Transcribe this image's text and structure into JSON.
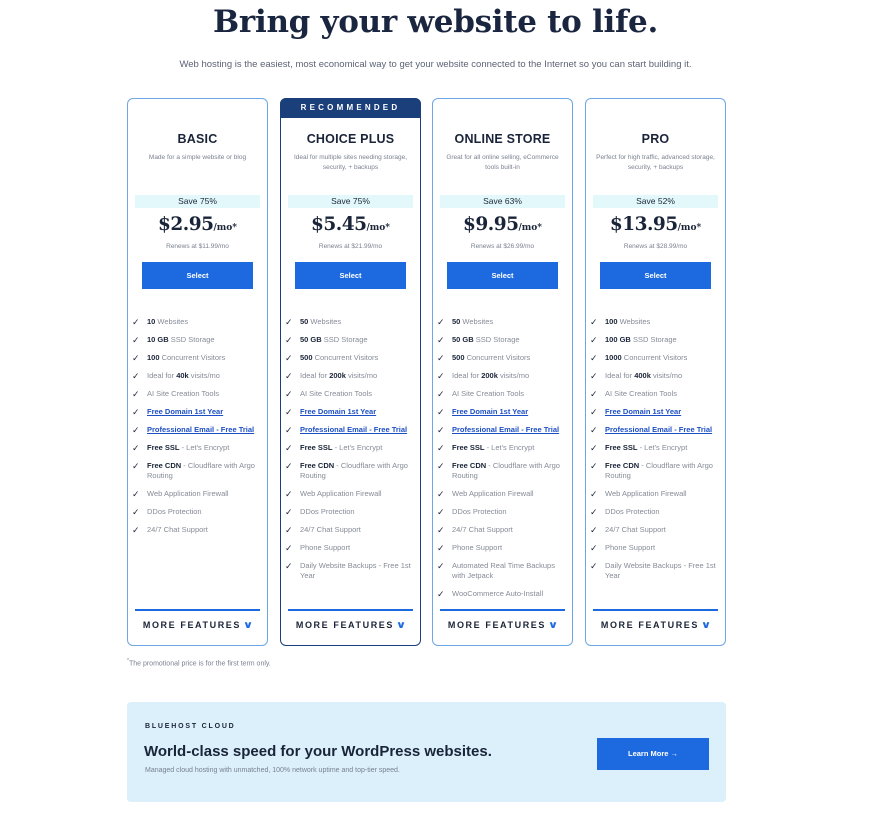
{
  "hero": {
    "title": "Bring your website to life.",
    "subtitle": "Web hosting is the easiest, most economical way to get your website connected to the Internet so you can start building it."
  },
  "colors": {
    "primary_blue": "#1d6ae0",
    "navy": "#1b3f7a",
    "card_border": "#6ea6e6",
    "save_badge_bg": "#e3f8fb",
    "cloud_bg": "#dbf0fb"
  },
  "plans": [
    {
      "name": "BASIC",
      "recommended": false,
      "description": "Made for a simple website or blog",
      "save": "Save 75%",
      "price": "$2.95",
      "per": "/mo*",
      "renews": "Renews at $11.99/mo",
      "select_label": "Select",
      "more_features_label": "MORE FEATURES",
      "features": [
        {
          "bold": "10",
          "text": " Websites"
        },
        {
          "bold": "10 GB",
          "text": " SSD Storage"
        },
        {
          "bold": "100",
          "text": " Concurrent Visitors"
        },
        {
          "pre": "Ideal for ",
          "bold": "40k",
          "text": " visits/mo"
        },
        {
          "text": "AI Site Creation Tools"
        },
        {
          "link": "Free Domain 1st Year"
        },
        {
          "link": "Professional Email - Free Trial"
        },
        {
          "bold": "Free SSL",
          "text": " - Let's Encrypt"
        },
        {
          "bold": "Free CDN",
          "text": " - Cloudflare with Argo Routing"
        },
        {
          "text": "Web Application Firewall"
        },
        {
          "text": "DDos Protection"
        },
        {
          "text": "24/7 Chat Support"
        }
      ]
    },
    {
      "name": "CHOICE PLUS",
      "recommended": true,
      "recommended_label": "RECOMMENDED",
      "description": "Ideal for multiple sites needing storage, security, + backups",
      "save": "Save 75%",
      "price": "$5.45",
      "per": "/mo*",
      "renews": "Renews at $21.99/mo",
      "select_label": "Select",
      "more_features_label": "MORE FEATURES",
      "features": [
        {
          "bold": "50",
          "text": " Websites"
        },
        {
          "bold": "50 GB",
          "text": " SSD Storage"
        },
        {
          "bold": "500",
          "text": " Concurrent Visitors"
        },
        {
          "pre": "Ideal for ",
          "bold": "200k",
          "text": " visits/mo"
        },
        {
          "text": "AI Site Creation Tools"
        },
        {
          "link": "Free Domain 1st Year"
        },
        {
          "link": "Professional Email - Free Trial"
        },
        {
          "bold": "Free SSL",
          "text": " - Let's Encrypt"
        },
        {
          "bold": "Free CDN",
          "text": " - Cloudflare with Argo Routing"
        },
        {
          "text": "Web Application Firewall"
        },
        {
          "text": "DDos Protection"
        },
        {
          "text": "24/7 Chat Support"
        },
        {
          "text": "Phone Support"
        },
        {
          "text": "Daily Website Backups - Free 1st Year"
        }
      ]
    },
    {
      "name": "ONLINE STORE",
      "recommended": false,
      "description": "Great for all online selling, eCommerce tools built-in",
      "save": "Save 63%",
      "price": "$9.95",
      "per": "/mo*",
      "renews": "Renews at $26.99/mo",
      "select_label": "Select",
      "more_features_label": "MORE FEATURES",
      "features": [
        {
          "bold": "50",
          "text": " Websites"
        },
        {
          "bold": "50 GB",
          "text": " SSD Storage"
        },
        {
          "bold": "500",
          "text": " Concurrent Visitors"
        },
        {
          "pre": "Ideal for ",
          "bold": "200k",
          "text": " visits/mo"
        },
        {
          "text": "AI Site Creation Tools"
        },
        {
          "link": "Free Domain 1st Year"
        },
        {
          "link": "Professional Email - Free Trial"
        },
        {
          "bold": "Free SSL",
          "text": " - Let's Encrypt"
        },
        {
          "bold": "Free CDN",
          "text": " - Cloudflare with Argo Routing"
        },
        {
          "text": "Web Application Firewall"
        },
        {
          "text": "DDos Protection"
        },
        {
          "text": "24/7 Chat Support"
        },
        {
          "text": "Phone Support"
        },
        {
          "text": "Automated Real Time Backups with Jetpack"
        },
        {
          "text": "WooCommerce Auto-Install"
        }
      ]
    },
    {
      "name": "PRO",
      "recommended": false,
      "description": "Perfect for high traffic, advanced storage, security, + backups",
      "save": "Save 52%",
      "price": "$13.95",
      "per": "/mo*",
      "renews": "Renews at $28.99/mo",
      "select_label": "Select",
      "more_features_label": "MORE FEATURES",
      "features": [
        {
          "bold": "100",
          "text": " Websites"
        },
        {
          "bold": "100 GB",
          "text": " SSD Storage"
        },
        {
          "bold": "1000",
          "text": " Concurrent Visitors"
        },
        {
          "pre": "Ideal for ",
          "bold": "400k",
          "text": " visits/mo"
        },
        {
          "text": "AI Site Creation Tools"
        },
        {
          "link": "Free Domain 1st Year"
        },
        {
          "link": "Professional Email - Free Trial"
        },
        {
          "bold": "Free SSL",
          "text": " - Let's Encrypt"
        },
        {
          "bold": "Free CDN",
          "text": " - Cloudflare with Argo Routing"
        },
        {
          "text": "Web Application Firewall"
        },
        {
          "text": "DDos Protection"
        },
        {
          "text": "24/7 Chat Support"
        },
        {
          "text": "Phone Support"
        },
        {
          "text": "Daily Website Backups - Free 1st Year"
        }
      ]
    }
  ],
  "icons": {
    "check": "✓",
    "chevron_down": "∨",
    "arrow_right": "→"
  },
  "footnote": {
    "marker": "*",
    "text": "The promotional price is for the first term only."
  },
  "cloud": {
    "eyebrow": "BLUEHOST CLOUD",
    "title": "World-class speed for your WordPress websites.",
    "subtitle": "Managed cloud hosting with unmatched, 100% network uptime and top-tier speed.",
    "button_label": "Learn More",
    "button_icon": "→"
  }
}
